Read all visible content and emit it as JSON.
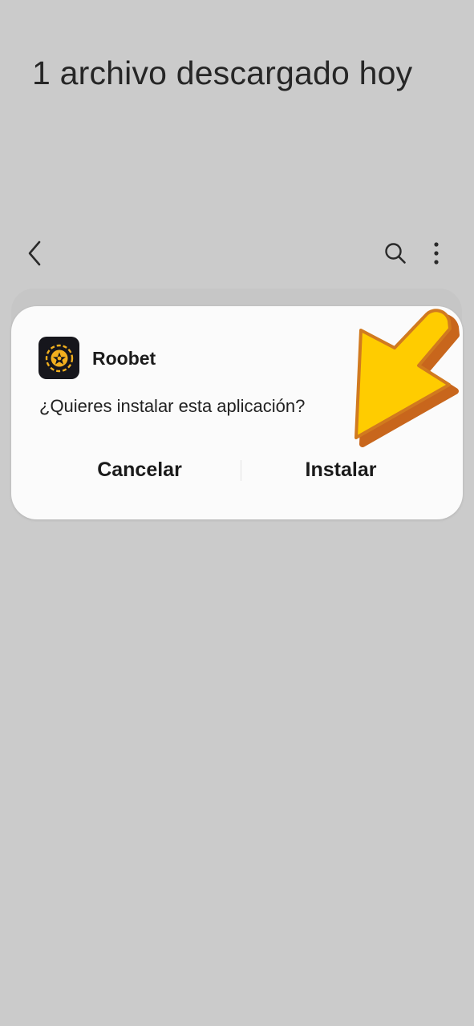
{
  "header": {
    "title": "1 archivo descargado hoy"
  },
  "toolbar": {
    "back_icon": "chevron-left-icon",
    "search_icon": "search-icon",
    "more_icon": "more-vertical-icon"
  },
  "dialog": {
    "app_name": "Roobet",
    "app_icon": "roobet-logo-icon",
    "message": "¿Quieres instalar esta aplicación?",
    "cancel_label": "Cancelar",
    "install_label": "Instalar"
  },
  "overlay": {
    "arrow_icon": "pointer-arrow-icon",
    "arrow_fill": "#ffcc00",
    "arrow_shadow": "#c8661c"
  },
  "colors": {
    "background": "#cbcbcb",
    "dialog_surface": "#fbfbfb",
    "app_icon_bg": "#16161c",
    "app_icon_accent": "#f2b01e"
  }
}
